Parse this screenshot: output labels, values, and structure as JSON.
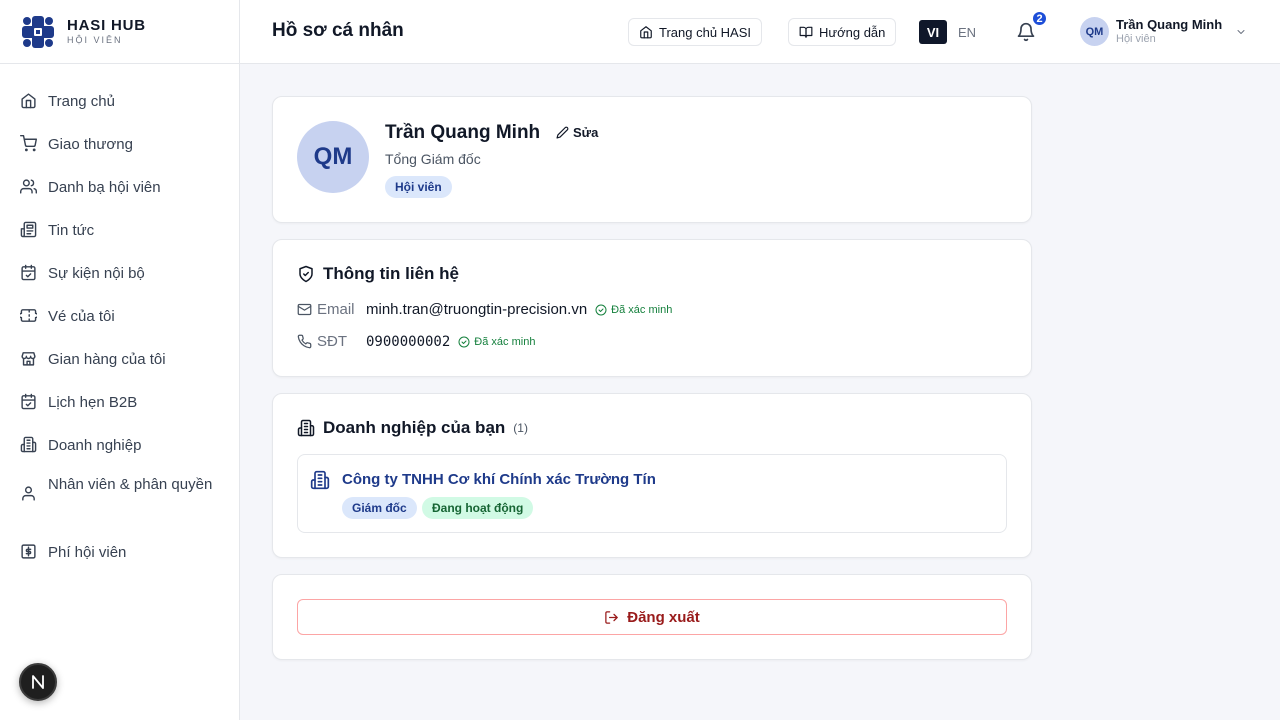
{
  "brand": {
    "name": "HASI HUB",
    "subtitle": "HỘI VIÊN"
  },
  "sidebar": {
    "items": [
      {
        "label": "Trang chủ",
        "icon": "home-icon"
      },
      {
        "label": "Giao thương",
        "icon": "cart-icon"
      },
      {
        "label": "Danh bạ hội viên",
        "icon": "users-icon"
      },
      {
        "label": "Tin tức",
        "icon": "newspaper-icon"
      },
      {
        "label": "Sự kiện nội bộ",
        "icon": "calendar-check-icon"
      },
      {
        "label": "Vé của tôi",
        "icon": "ticket-icon"
      },
      {
        "label": "Gian hàng của tôi",
        "icon": "store-icon"
      },
      {
        "label": "Lịch hẹn B2B",
        "icon": "calendar-check-icon"
      },
      {
        "label": "Doanh nghiệp",
        "icon": "building-icon"
      },
      {
        "label": "Nhân viên & phân quyền",
        "icon": "user-icon"
      },
      {
        "label": "Phí hội viên",
        "icon": "dollar-icon"
      }
    ]
  },
  "header": {
    "title": "Hồ sơ cá nhân",
    "home_button": "Trang chủ HASI",
    "guide_button": "Hướng dẫn",
    "lang_vi": "VI",
    "lang_en": "EN",
    "notification_count": "2",
    "user": {
      "initials": "QM",
      "name": "Trần Quang Minh",
      "role": "Hội viên"
    }
  },
  "profile": {
    "initials": "QM",
    "name": "Trần Quang Minh",
    "edit_label": "Sửa",
    "job_title": "Tổng Giám đốc",
    "badge": "Hội viên"
  },
  "contact": {
    "title": "Thông tin liên hệ",
    "email_label": "Email",
    "email": "minh.tran@truongtin-precision.vn",
    "phone_label": "SĐT",
    "phone": "0900000002",
    "verified_label": "Đã xác minh"
  },
  "business": {
    "title": "Doanh nghiệp của bạn",
    "count": "(1)",
    "companies": [
      {
        "name": "Công ty TNHH Cơ khí Chính xác Trường Tín",
        "role": "Giám đốc",
        "status": "Đang hoạt động"
      }
    ]
  },
  "logout": {
    "label": "Đăng xuất"
  },
  "colors": {
    "accent": "#1e3a8a",
    "success": "#15803d",
    "danger": "#991b1b",
    "badge": "#1d4ed8"
  }
}
